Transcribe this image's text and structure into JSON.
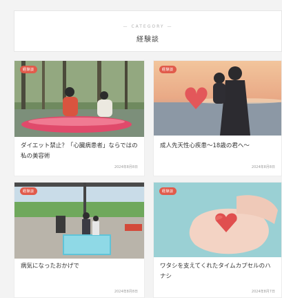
{
  "category": {
    "label": "— CATEGORY —",
    "title": "経験談"
  },
  "cards": [
    {
      "badge": "経験談",
      "title": "ダイエット禁止？「心臓病患者」ならではの私の美容術",
      "date": "2024年8月8日"
    },
    {
      "badge": "経験談",
      "title": "成人先天性心疾患～18歳の君へ～",
      "date": "2024年8月8日"
    },
    {
      "badge": "経験談",
      "title": "病気になったおかげで",
      "date": "2024年8月8日"
    },
    {
      "badge": "経験談",
      "title": "ワタシを支えてくれたタイムカプセルのハナシ",
      "date": "2024年8月7日"
    }
  ],
  "colors": {
    "badge": "#e15b4b",
    "background": "#f3f3f3"
  }
}
